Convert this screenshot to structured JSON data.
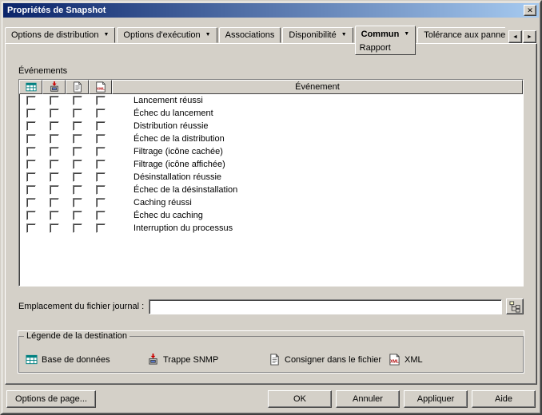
{
  "window": {
    "title": "Propriétés de Snapshot"
  },
  "icons": {
    "dropdown": "▼",
    "close": "✕",
    "scroll_left": "◄",
    "scroll_right": "►"
  },
  "tabs": {
    "items": [
      {
        "label": "Options de distribution"
      },
      {
        "label": "Options d'exécution"
      },
      {
        "label": "Associations"
      },
      {
        "label": "Disponibilité"
      },
      {
        "label": "Commun",
        "sub_label": "Rapport"
      },
      {
        "label": "Tolérance aux panne"
      }
    ]
  },
  "events": {
    "group_label": "Événements",
    "column_header": "Événement",
    "rows": [
      "Lancement réussi",
      "Échec du lancement",
      "Distribution réussie",
      "Échec de la distribution",
      "Filtrage (icône cachée)",
      "Filtrage (icône affichée)",
      "Désinstallation réussie",
      "Échec de la désinstallation",
      "Caching réussi",
      "Échec du caching",
      "Interruption du processus"
    ]
  },
  "log_file": {
    "label": "Emplacement du fichier journal :",
    "value": ""
  },
  "legend": {
    "title": "Légende de la destination",
    "items": [
      {
        "label": "Base de données",
        "icon": "database-icon"
      },
      {
        "label": "Trappe SNMP",
        "icon": "snmp-trap-icon"
      },
      {
        "label": "Consigner dans le fichier",
        "icon": "logfile-icon"
      },
      {
        "label": "XML",
        "icon": "xml-icon"
      }
    ]
  },
  "buttons": {
    "page_options": "Options de page...",
    "ok": "OK",
    "cancel": "Annuler",
    "apply": "Appliquer",
    "help": "Aide"
  }
}
